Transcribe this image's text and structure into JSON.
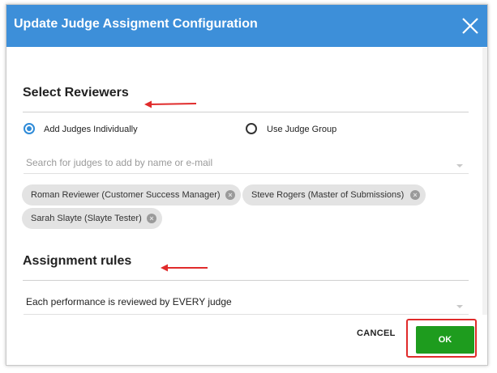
{
  "dialog": {
    "title": "Update Judge Assigment Configuration",
    "close_icon": "close-icon"
  },
  "reviewers": {
    "title": "Select Reviewers",
    "options": [
      {
        "label": "Add Judges Individually",
        "selected": true
      },
      {
        "label": "Use Judge Group",
        "selected": false
      }
    ],
    "search": {
      "placeholder": "Search for judges to add by name or e-mail",
      "value": ""
    },
    "chips": [
      {
        "label": "Roman Reviewer (Customer Success Manager)"
      },
      {
        "label": "Steve Rogers (Master of Submissions)"
      },
      {
        "label": "Sarah Slayte (Slayte Tester)"
      }
    ]
  },
  "rules": {
    "title": "Assignment rules",
    "selected_rule": "Each performance is reviewed by EVERY judge"
  },
  "footer": {
    "cancel_label": "CANCEL",
    "ok_label": "OK"
  },
  "colors": {
    "header": "#3d8fd9",
    "ok": "#1e9c1e",
    "annotation": "#e02b2b",
    "radio_selected": "#2f8bd8"
  }
}
